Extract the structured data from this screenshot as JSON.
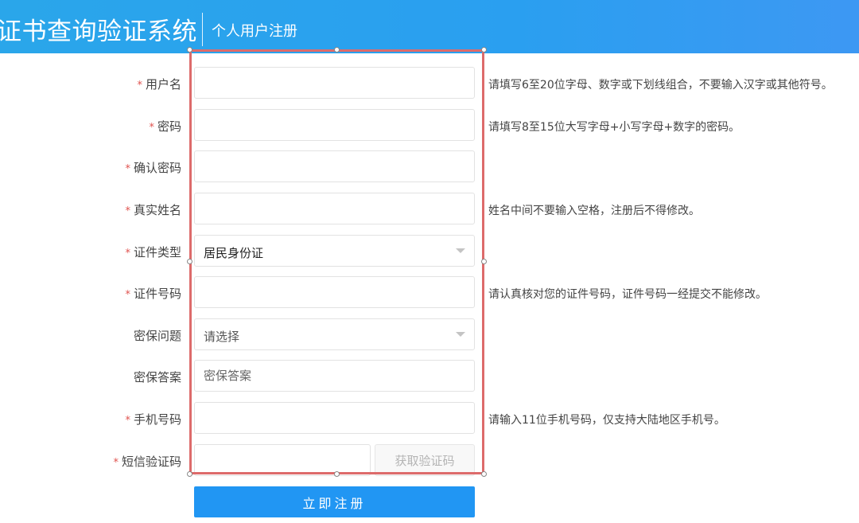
{
  "header": {
    "app_title": "证书查询验证系统",
    "page_title": "个人用户注册"
  },
  "form": {
    "required_mark": "*",
    "fields": [
      {
        "label": "用户名",
        "value": "",
        "hint": "请填写6至20位字母、数字或下划线组合，不要输入汉字或其他符号。"
      },
      {
        "label": "密码",
        "value": "",
        "hint": "请填写8至15位大写字母+小写字母+数字的密码。"
      },
      {
        "label": "确认密码",
        "value": ""
      },
      {
        "label": "真实姓名",
        "value": "",
        "hint": "姓名中间不要输入空格，注册后不得修改。"
      },
      {
        "label": "证件类型",
        "selected": "居民身份证"
      },
      {
        "label": "证件号码",
        "value": "",
        "hint": "请认真核对您的证件号码，证件号码一经提交不能修改。"
      },
      {
        "label": "密保问题",
        "placeholder": "请选择"
      },
      {
        "label": "密保答案",
        "placeholder": "密保答案"
      },
      {
        "label": "手机号码",
        "value": "",
        "hint": "请输入11位手机号码，仅支持大陆地区手机号。"
      },
      {
        "label": "短信验证码",
        "value": "",
        "button": "获取验证码"
      }
    ],
    "submit_label": "立即注册"
  },
  "colors": {
    "header": "#2aa6ea",
    "primary_button": "#2196f3",
    "required": "#e0534f",
    "selection_border": "#dd6b6b"
  },
  "icons": {
    "dropdown": "caret-down-icon"
  }
}
